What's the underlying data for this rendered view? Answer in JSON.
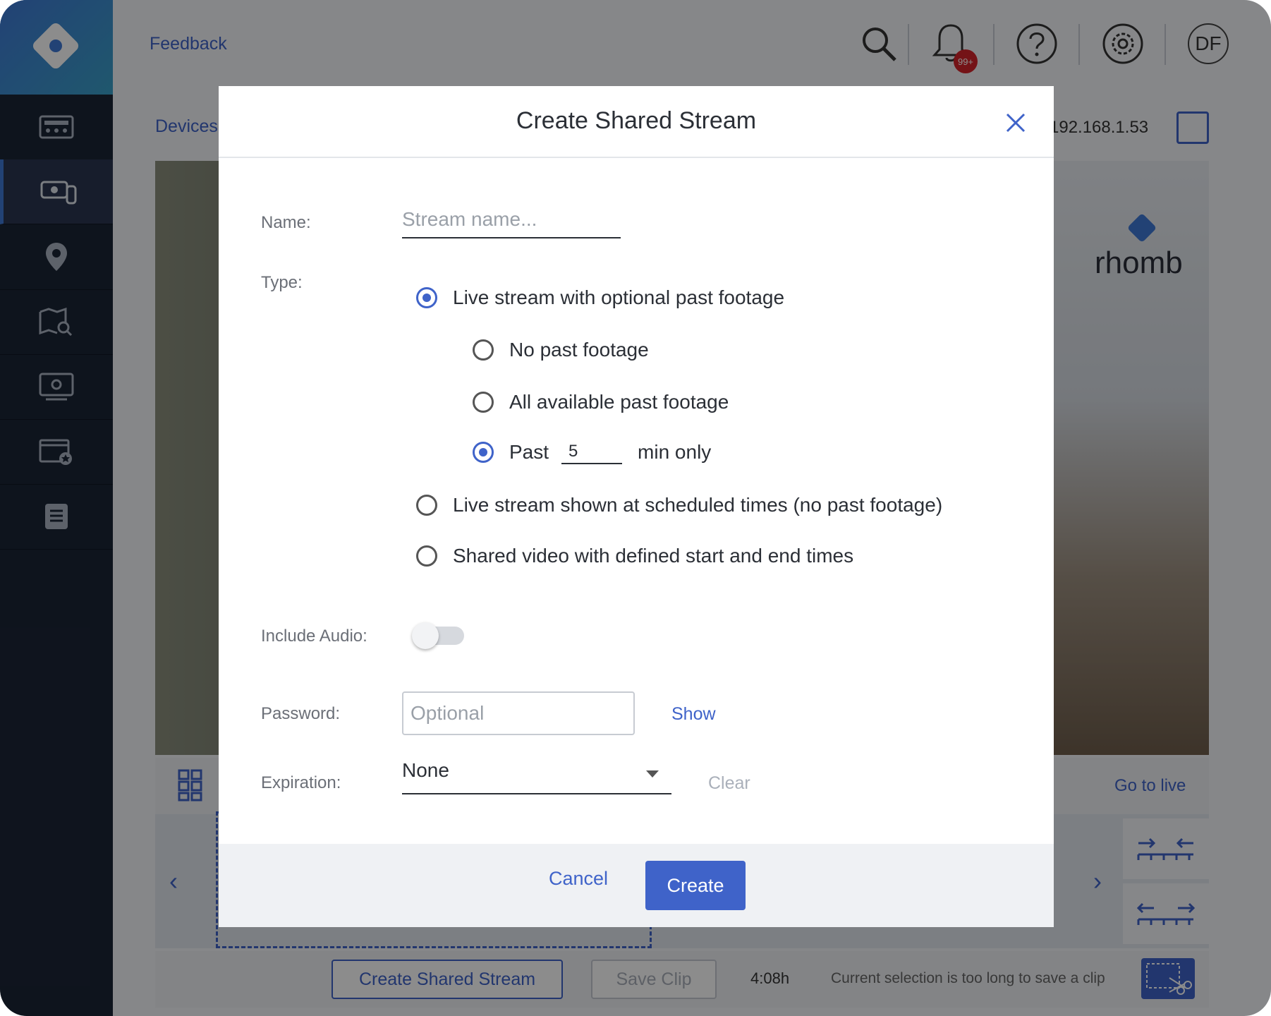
{
  "topbar": {
    "feedback_label": "Feedback",
    "notifications_badge": "99+",
    "avatar_initials": "DF"
  },
  "page": {
    "breadcrumb": "Devices",
    "ip_address": "192.168.1.53"
  },
  "video": {
    "logo_text": "rhomb"
  },
  "timeline": {
    "go_live_label": "Go to live"
  },
  "bottombar": {
    "create_shared_stream_label": "Create Shared Stream",
    "save_clip_label": "Save Clip",
    "duration": "4:08h",
    "hint": "Current selection is too long to save a clip"
  },
  "modal": {
    "title": "Create Shared Stream",
    "name_label": "Name:",
    "name_placeholder": "Stream name...",
    "name_value": "",
    "type_label": "Type:",
    "type_options": [
      {
        "label": "Live stream with optional past footage",
        "checked": true
      },
      {
        "label": "Live stream shown at scheduled times (no past footage)",
        "checked": false
      },
      {
        "label": "Shared video with defined start and end times",
        "checked": false
      }
    ],
    "past_options": [
      {
        "label": "No past footage",
        "checked": false
      },
      {
        "label": "All available past footage",
        "checked": false
      },
      {
        "label_prefix": "Past",
        "minutes": "5",
        "label_suffix": "min only",
        "checked": true
      }
    ],
    "include_audio_label": "Include Audio:",
    "include_audio": false,
    "password_label": "Password:",
    "password_placeholder": "Optional",
    "show_label": "Show",
    "expiration_label": "Expiration:",
    "expiration_value": "None",
    "clear_label": "Clear",
    "cancel_label": "Cancel",
    "create_label": "Create"
  },
  "colors": {
    "accent": "#3f63c9",
    "sidebar": "#1b2536"
  }
}
